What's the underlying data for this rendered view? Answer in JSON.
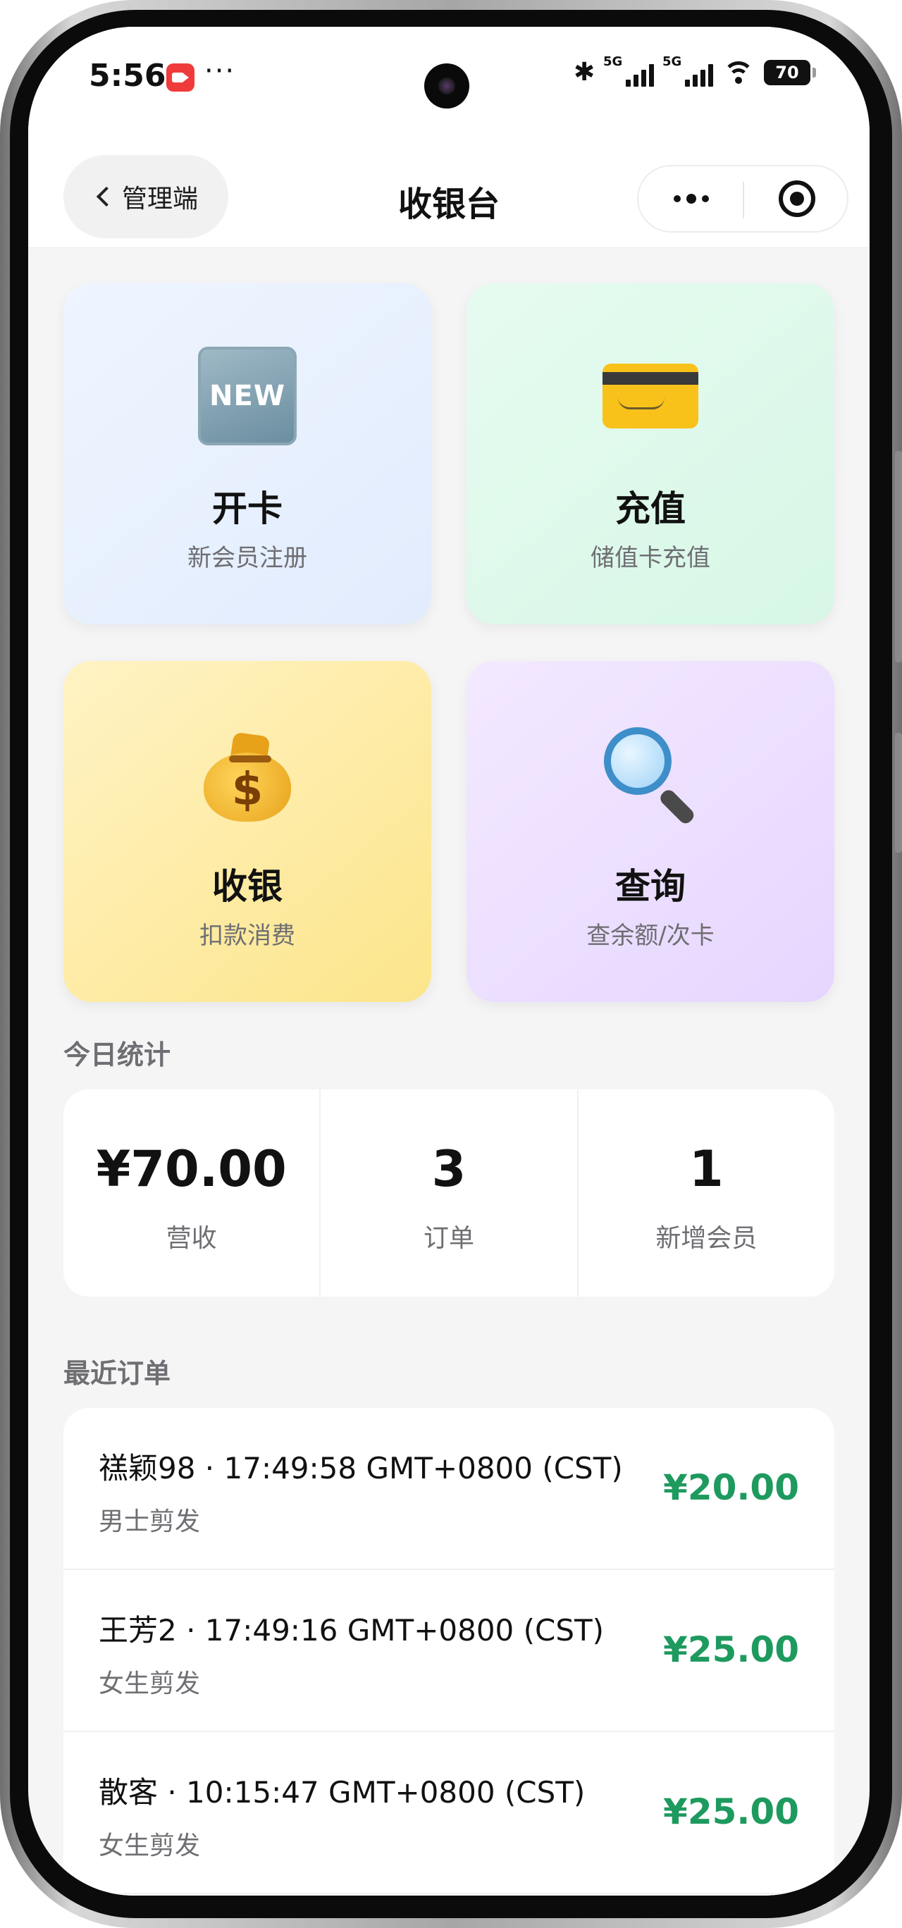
{
  "status_bar": {
    "time": "5:56",
    "more": "···",
    "sig1_label": "5G",
    "sig2_label": "5G",
    "battery": "70",
    "bluetooth_glyph": "✱"
  },
  "nav": {
    "back_label": "管理端",
    "title": "收银台"
  },
  "actions": [
    {
      "icon": "new-badge-icon",
      "badge": "NEW",
      "title": "开卡",
      "subtitle": "新会员注册"
    },
    {
      "icon": "credit-card-icon",
      "title": "充值",
      "subtitle": "储值卡充值"
    },
    {
      "icon": "money-bag-icon",
      "symbol": "$",
      "title": "收银",
      "subtitle": "扣款消费"
    },
    {
      "icon": "magnifier-icon",
      "title": "查询",
      "subtitle": "查余额/次卡"
    }
  ],
  "stats": {
    "section_title": "今日统计",
    "revenue": {
      "value": "¥70.00",
      "label": "营收"
    },
    "orders": {
      "value": "3",
      "label": "订单"
    },
    "new_members": {
      "value": "1",
      "label": "新增会员"
    }
  },
  "recent_orders": {
    "section_title": "最近订单",
    "items": [
      {
        "title": "禚颖98 · 17:49:58 GMT+0800 (CST)",
        "service": "男士剪发",
        "amount": "¥20.00"
      },
      {
        "title": "王芳2 · 17:49:16 GMT+0800 (CST)",
        "service": "女生剪发",
        "amount": "¥25.00"
      },
      {
        "title": "散客 · 10:15:47 GMT+0800 (CST)",
        "service": "女生剪发",
        "amount": "¥25.00"
      }
    ]
  },
  "colors": {
    "amount_green": "#1e9a5f",
    "card_blue": "#e2ecfd",
    "card_green": "#d7f7e6",
    "card_yellow": "#fce58b",
    "card_purple": "#e6d6ff"
  }
}
